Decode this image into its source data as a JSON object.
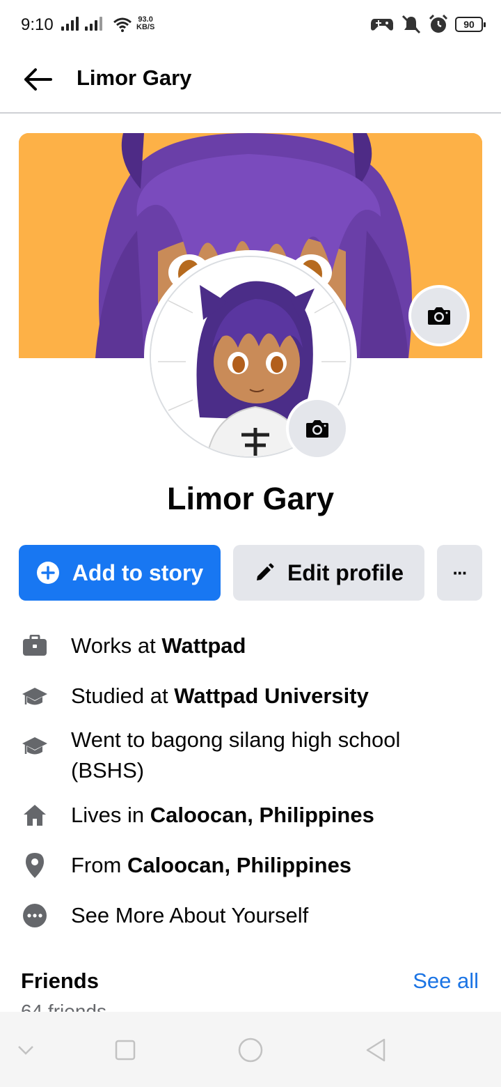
{
  "status_bar": {
    "time": "9:10",
    "net_speed_value": "93.0",
    "net_speed_unit": "KB/S",
    "battery": "90"
  },
  "header": {
    "title": "Limor Gary"
  },
  "profile": {
    "name": "Limor Gary"
  },
  "actions": {
    "add_story": "Add to story",
    "edit_profile": "Edit profile",
    "more": "···"
  },
  "intro": {
    "works_prefix": "Works at ",
    "works_value": "Wattpad",
    "studied_prefix": "Studied at ",
    "studied_value": "Wattpad University",
    "went_to": "Went to bagong silang high school (BSHS)",
    "lives_prefix": "Lives in ",
    "lives_value": "Caloocan, Philippines",
    "from_prefix": "From ",
    "from_value": "Caloocan, Philippines",
    "see_more": "See More About Yourself"
  },
  "friends": {
    "title": "Friends",
    "see_all": "See all",
    "count": "64 friends"
  },
  "colors": {
    "accent": "#1877f2",
    "link": "#1b74e4",
    "button_gray": "#e4e6eb",
    "cover_bg": "#fdb147"
  }
}
